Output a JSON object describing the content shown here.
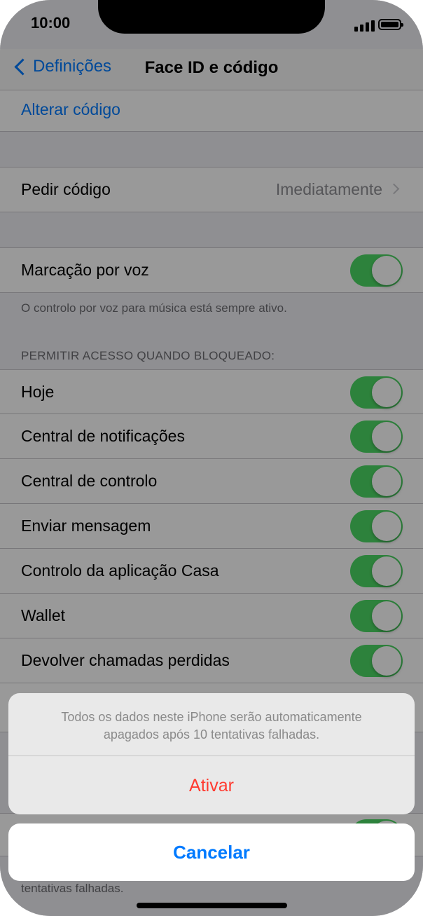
{
  "status_bar": {
    "time": "10:00"
  },
  "nav": {
    "back_label": "Definições",
    "title": "Face ID e código"
  },
  "rows": {
    "change_passcode": "Alterar código",
    "require_passcode": {
      "label": "Pedir código",
      "value": "Imediatamente"
    },
    "voice_dial": {
      "label": "Marcação por voz",
      "on": true
    }
  },
  "voice_footer": "O controlo por voz para música está sempre ativo.",
  "locked_access": {
    "header": "PERMITIR ACESSO QUANDO BLOQUEADO:",
    "items": [
      {
        "label": "Hoje",
        "on": true
      },
      {
        "label": "Central de notificações",
        "on": true
      },
      {
        "label": "Central de controlo",
        "on": true
      },
      {
        "label": "Enviar mensagem",
        "on": true
      },
      {
        "label": "Controlo da aplicação Casa",
        "on": true
      },
      {
        "label": "Wallet",
        "on": true
      },
      {
        "label": "Devolver chamadas perdidas",
        "on": true
      }
    ]
  },
  "erase_footer_fragment": "tentativas falhadas.",
  "action_sheet": {
    "message": "Todos os dados neste iPhone serão automaticamente apagados após 10 tentativas falhadas.",
    "activate_label": "Ativar",
    "cancel_label": "Cancelar"
  },
  "colors": {
    "accent": "#007aff",
    "toggle_on": "#4cd964",
    "destructive": "#ff3b30"
  }
}
